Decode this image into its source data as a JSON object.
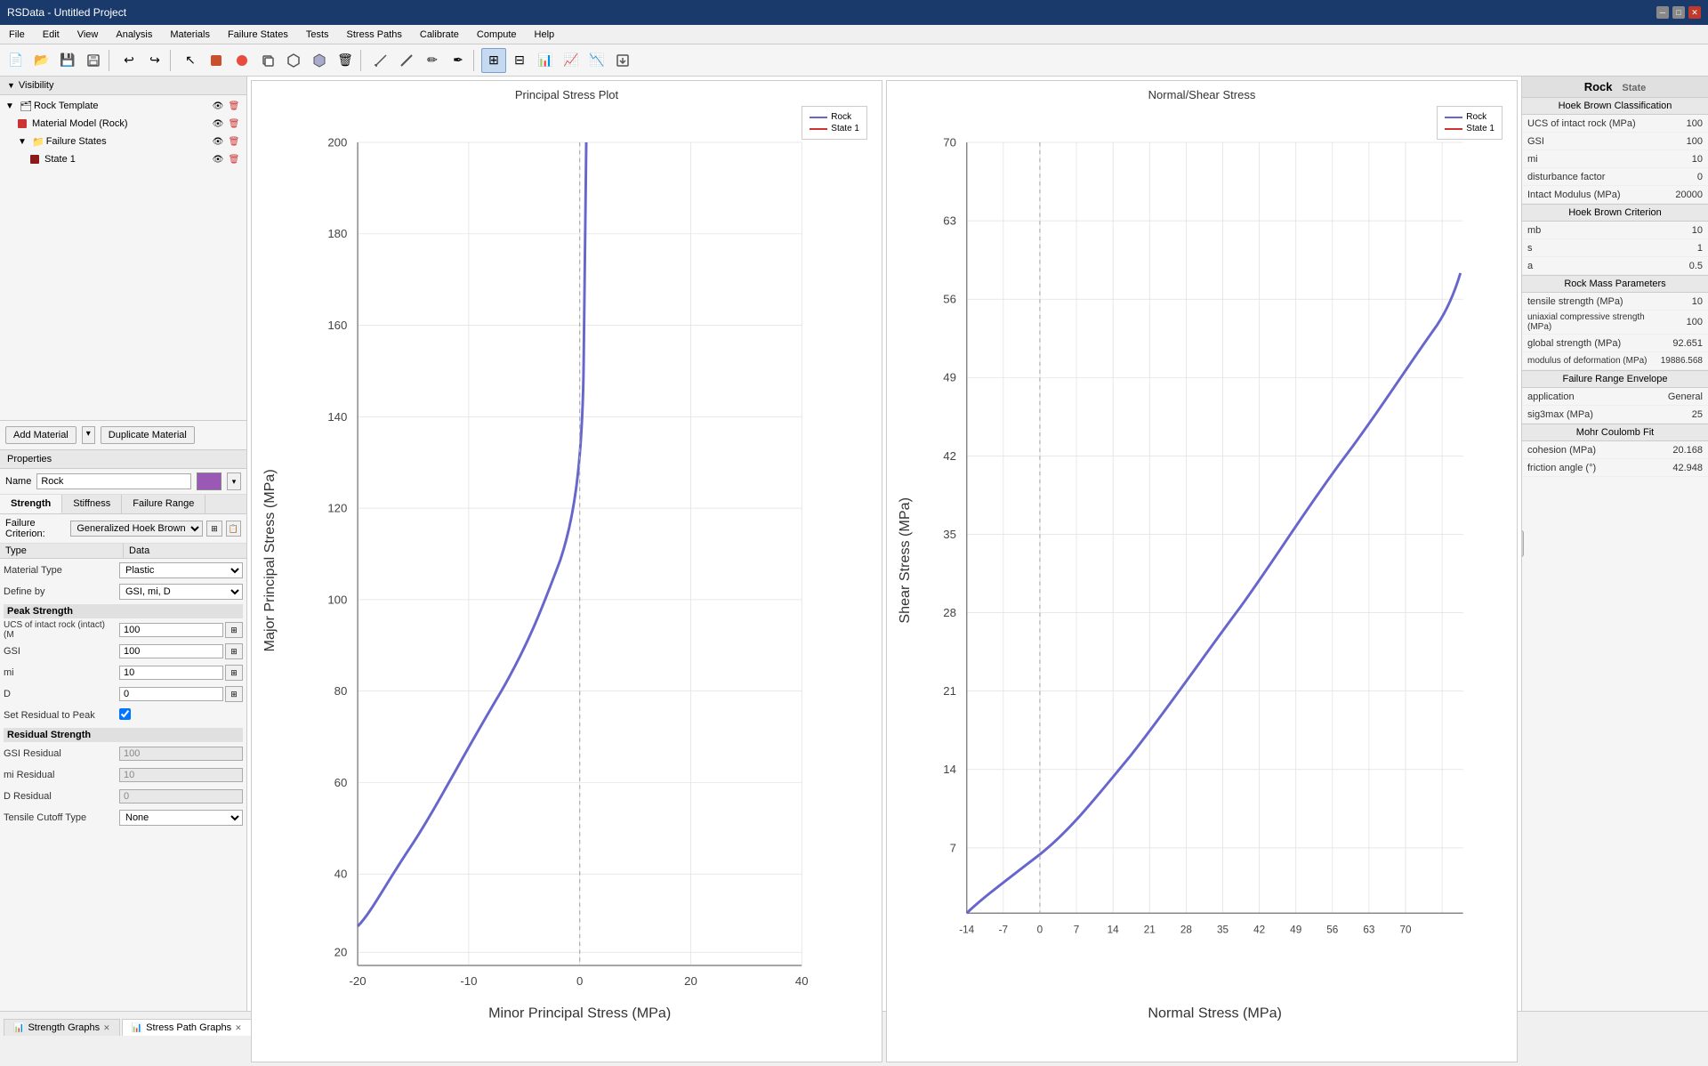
{
  "app": {
    "title": "RSData - Untitled Project",
    "window_controls": [
      "minimize",
      "maximize",
      "close"
    ]
  },
  "menu": {
    "items": [
      "File",
      "Edit",
      "View",
      "Analysis",
      "Materials",
      "Failure States",
      "Tests",
      "Stress Paths",
      "Calibrate",
      "Compute",
      "Help"
    ]
  },
  "toolbar": {
    "buttons": [
      {
        "name": "new",
        "icon": "📄"
      },
      {
        "name": "open",
        "icon": "📂"
      },
      {
        "name": "save",
        "icon": "💾"
      },
      {
        "name": "save-as",
        "icon": "💾"
      },
      {
        "name": "undo",
        "icon": "↩"
      },
      {
        "name": "redo",
        "icon": "↪"
      },
      {
        "name": "select",
        "icon": "↖"
      },
      {
        "name": "add-rock",
        "icon": "🟫"
      },
      {
        "name": "add-material",
        "icon": "🔴"
      },
      {
        "name": "duplicate",
        "icon": "📋"
      },
      {
        "name": "add-joint",
        "icon": "⬡"
      },
      {
        "name": "add-state",
        "icon": "⬢"
      },
      {
        "name": "delete",
        "icon": "🗑"
      },
      {
        "name": "tool1",
        "icon": "📐"
      },
      {
        "name": "tool2",
        "icon": "📏"
      },
      {
        "name": "tool3",
        "icon": "✏"
      },
      {
        "name": "tool4",
        "icon": "✒"
      },
      {
        "name": "active-tool",
        "icon": "⊞"
      },
      {
        "name": "table",
        "icon": "⊟"
      },
      {
        "name": "chart1",
        "icon": "📊"
      },
      {
        "name": "chart2",
        "icon": "📈"
      },
      {
        "name": "chart3",
        "icon": "📉"
      },
      {
        "name": "export",
        "icon": "⬜"
      }
    ]
  },
  "visibility": {
    "header": "Visibility",
    "tree": [
      {
        "level": 0,
        "label": "Rock Template",
        "type": "group",
        "expanded": true
      },
      {
        "level": 1,
        "label": "Material Model (Rock)",
        "type": "material"
      },
      {
        "level": 1,
        "label": "Failure States",
        "type": "group",
        "expanded": true
      },
      {
        "level": 2,
        "label": "State 1",
        "type": "state"
      }
    ],
    "add_material_btn": "Add Material",
    "duplicate_btn": "Duplicate Material"
  },
  "properties": {
    "header": "Properties",
    "name_label": "Name",
    "name_value": "Rock",
    "tabs": [
      "Strength",
      "Stiffness",
      "Failure Range"
    ],
    "active_tab": "Strength",
    "failure_criterion_label": "Failure Criterion:",
    "failure_criterion_value": "Generalized Hoek Brown",
    "table_headers": [
      "Type",
      "Data"
    ],
    "material_type_label": "Material Type",
    "material_type_value": "Plastic",
    "define_by_label": "Define by",
    "define_by_value": "GSI, mi, D",
    "peak_strength_header": "Peak Strength",
    "ucs_label": "UCS of intact rock (intact) (M",
    "ucs_value": "100",
    "gsi_label": "GSI",
    "gsi_value": "100",
    "mi_label": "mi",
    "mi_value": "10",
    "d_label": "D",
    "d_value": "0",
    "set_residual_label": "Set Residual to Peak",
    "residual_header": "Residual Strength",
    "gsi_residual_label": "GSI Residual",
    "gsi_residual_value": "100",
    "mi_residual_label": "mi Residual",
    "mi_residual_value": "10",
    "d_residual_label": "D Residual",
    "d_residual_value": "0",
    "tensile_cutoff_label": "Tensile Cutoff Type",
    "tensile_cutoff_value": "None"
  },
  "graphs": {
    "left_title": "Principal Stress Plot",
    "right_title": "Normal/Shear Stress",
    "left_legend": {
      "rock_label": "Rock",
      "state1_label": "State 1"
    },
    "right_legend": {
      "rock_label": "Rock",
      "state1_label": "State 1"
    },
    "left_x_axis": "Minor Principal Stress (MPa)",
    "left_y_axis": "Major Principal Stress (MPa)",
    "right_x_axis": "Normal Stress (MPa)",
    "right_y_axis": "Shear Stress (MPa)",
    "left_x_ticks": [
      "-20",
      "0",
      "20",
      "40"
    ],
    "left_y_ticks": [
      "20",
      "40",
      "60",
      "80",
      "100",
      "120",
      "140",
      "160",
      "180",
      "200"
    ],
    "right_x_ticks": [
      "-14",
      "-7",
      "0",
      "7",
      "14",
      "21",
      "28",
      "35",
      "42",
      "49",
      "56",
      "63",
      "70"
    ],
    "right_y_ticks": [
      "7",
      "14",
      "21",
      "28",
      "35",
      "42",
      "49",
      "56",
      "63",
      "70"
    ]
  },
  "rock_state_panel": {
    "title": "Rock",
    "section_hoek_brown_class": "Hoek Brown Classification",
    "ucs_label": "UCS of intact rock (MPa)",
    "ucs_value": "100",
    "gsi_label": "GSI",
    "gsi_value": "100",
    "mi_label": "mi",
    "mi_value": "10",
    "disturbance_label": "disturbance factor",
    "disturbance_value": "0",
    "intact_modulus_label": "Intact Modulus (MPa)",
    "intact_modulus_value": "20000",
    "section_hoek_brown_criterion": "Hoek Brown Criterion",
    "mb_label": "mb",
    "mb_value": "10",
    "s_label": "s",
    "s_value": "1",
    "a_label": "a",
    "a_value": "0.5",
    "section_rock_mass": "Rock Mass Parameters",
    "tensile_label": "tensile strength (MPa)",
    "tensile_value": "10",
    "uniaxial_label": "uniaxial compressive strength (MPa)",
    "uniaxial_value": "100",
    "global_label": "global strength (MPa)",
    "global_value": "92.651",
    "modulus_def_label": "modulus of deformation (MPa)",
    "modulus_def_value": "19886.568",
    "section_failure_range": "Failure Range Envelope",
    "application_label": "application",
    "application_value": "General",
    "sig3max_label": "sig3max (MPa)",
    "sig3max_value": "25",
    "section_mohr_coulomb": "Mohr Coulomb Fit",
    "cohesion_label": "cohesion (MPa)",
    "cohesion_value": "20.168",
    "friction_angle_label": "friction angle (°)",
    "friction_angle_value": "42.948"
  },
  "bottom_tabs": {
    "tabs": [
      {
        "label": "Strength Graphs",
        "active": false
      },
      {
        "label": "Stress Path Graphs",
        "active": true
      }
    ],
    "add_label": "+",
    "menu_label": "▾"
  }
}
